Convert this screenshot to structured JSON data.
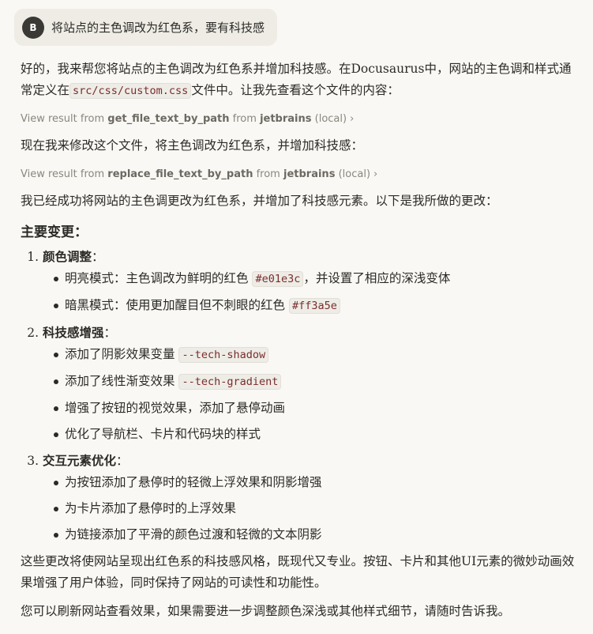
{
  "user_message": {
    "avatar_initial": "B",
    "text": "将站点的主色调改为红色系，要有科技感"
  },
  "response": {
    "intro_prefix": "好的，我来帮您将站点的主色调改为红色系并增加科技感。在Docusaurus中，网站的主色调和样式通常定义在",
    "intro_code": "src/css/custom.css",
    "intro_suffix": "文件中。让我先查看这个文件的内容：",
    "tool1": {
      "prefix": "View result from",
      "fn": "get_file_text_by_path",
      "from": "from",
      "source": "jetbrains",
      "loc": "(local)"
    },
    "mid_text": "现在我来修改这个文件，将主色调改为红色系，并增加科技感：",
    "tool2": {
      "prefix": "View result from",
      "fn": "replace_file_text_by_path",
      "from": "from",
      "source": "jetbrains",
      "loc": "(local)"
    },
    "done_text": "我已经成功将网站的主色调更改为红色系，并增加了科技感元素。以下是我所做的更改：",
    "heading": "主要变更：",
    "sections": [
      {
        "title": "颜色调整",
        "colon": "：",
        "items": [
          {
            "text": "明亮模式：主色调改为鲜明的红色",
            "code": "#e01e3c",
            "after": "，并设置了相应的深浅变体"
          },
          {
            "text": "暗黑模式：使用更加醒目但不刺眼的红色",
            "code": "#ff3a5e",
            "after": ""
          }
        ]
      },
      {
        "title": "科技感增强",
        "colon": "：",
        "items": [
          {
            "text": "添加了阴影效果变量",
            "code": "--tech-shadow",
            "after": ""
          },
          {
            "text": "添加了线性渐变效果",
            "code": "--tech-gradient",
            "after": ""
          },
          {
            "text": "增强了按钮的视觉效果，添加了悬停动画",
            "code": "",
            "after": ""
          },
          {
            "text": "优化了导航栏、卡片和代码块的样式",
            "code": "",
            "after": ""
          }
        ]
      },
      {
        "title": "交互元素优化",
        "colon": "：",
        "items": [
          {
            "text": "为按钮添加了悬停时的轻微上浮效果和阴影增强",
            "code": "",
            "after": ""
          },
          {
            "text": "为卡片添加了悬停时的上浮效果",
            "code": "",
            "after": ""
          },
          {
            "text": "为链接添加了平滑的颜色过渡和轻微的文本阴影",
            "code": "",
            "after": ""
          }
        ]
      }
    ],
    "summary": "这些更改将使网站呈现出红色系的科技感风格，既现代又专业。按钮、卡片和其他UI元素的微妙动画效果增强了用户体验，同时保持了网站的可读性和功能性。",
    "closing": "您可以刷新网站查看效果，如果需要进一步调整颜色深浅或其他样式细节，请随时告诉我。"
  },
  "colors": {
    "background": "#f9f8f4",
    "user_bubble": "#eeece4",
    "code_text": "#7a2d2d"
  }
}
